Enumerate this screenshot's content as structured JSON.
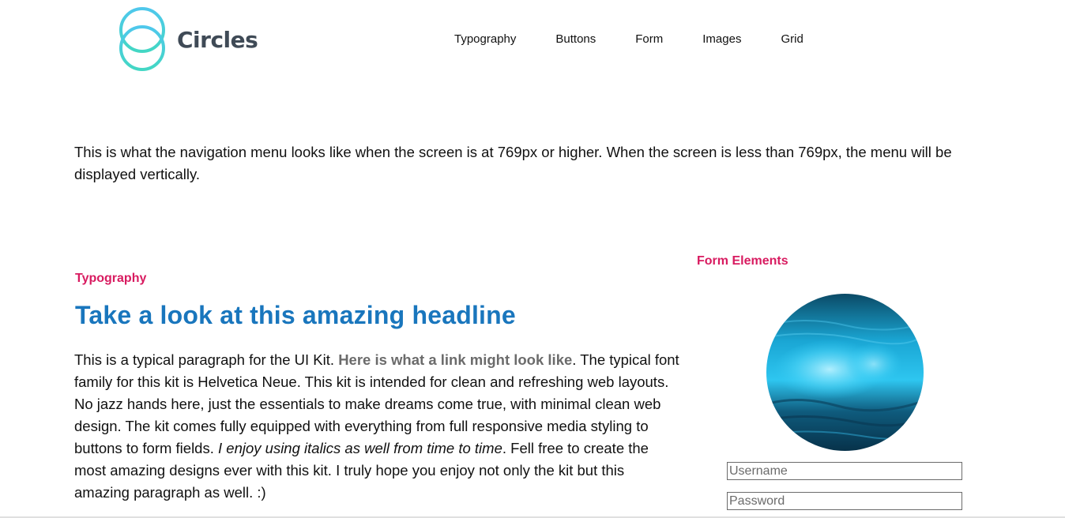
{
  "brand": {
    "name": "Circles",
    "ring_color_top": "#4fc8ec",
    "ring_color_bottom": "#43d7c4"
  },
  "nav": {
    "items": [
      "Typography",
      "Buttons",
      "Form",
      "Images",
      "Grid"
    ]
  },
  "intro": "This is what the navigation menu looks like when the screen is at 769px or higher. When the screen is less than 769px, the menu will be displayed vertically.",
  "typography": {
    "label": "Typography",
    "headline": "Take a look at this amazing headline",
    "p1": "This is a typical paragraph for the UI Kit. ",
    "link": "Here is what a link might look like",
    "p2": ". The typical font family for this kit is Helvetica Neue. This kit is intended for clean and refreshing web layouts. No jazz hands here, just the essentials to make dreams come true, with minimal clean web design. The kit comes fully equipped with everything from full responsive media styling to buttons to form fields. ",
    "italic": "I enjoy using italics as well from time to time",
    "p3": ". Fell free to create the most amazing designs ever with this kit. I truly hope you enjoy not only the kit but this amazing paragraph as well. :)"
  },
  "form": {
    "label": "Form Elements",
    "username_placeholder": "Username",
    "password_placeholder": "Password"
  },
  "colors": {
    "accent_pink": "#d81b60",
    "headline_blue": "#1976bd",
    "link_gray": "#6b6b6b",
    "wave_cyan": "#2ec6f0"
  }
}
